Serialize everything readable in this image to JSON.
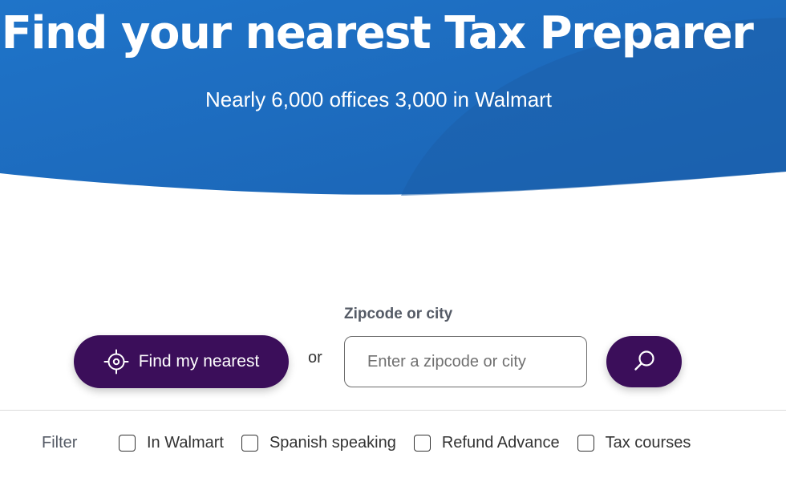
{
  "hero": {
    "title": "Find your nearest Tax Preparer",
    "subtitle": "Nearly 6,000 offices 3,000 in Walmart"
  },
  "search": {
    "zip_label": "Zipcode or city",
    "nearest_button": "Find my nearest",
    "or_text": "or",
    "placeholder": "Enter a zipcode or city",
    "value": ""
  },
  "filter": {
    "label": "Filter",
    "options": [
      {
        "label": "In Walmart",
        "checked": false
      },
      {
        "label": "Spanish speaking",
        "checked": false
      },
      {
        "label": "Refund Advance",
        "checked": false
      },
      {
        "label": "Tax courses",
        "checked": false
      }
    ]
  },
  "icons": {
    "nearest": "crosshair-location-icon",
    "search": "search-icon"
  },
  "colors": {
    "hero_blue": "#1f6fc2",
    "hero_blue_dark": "#1b5fae",
    "button_purple": "#3b0e5a"
  }
}
